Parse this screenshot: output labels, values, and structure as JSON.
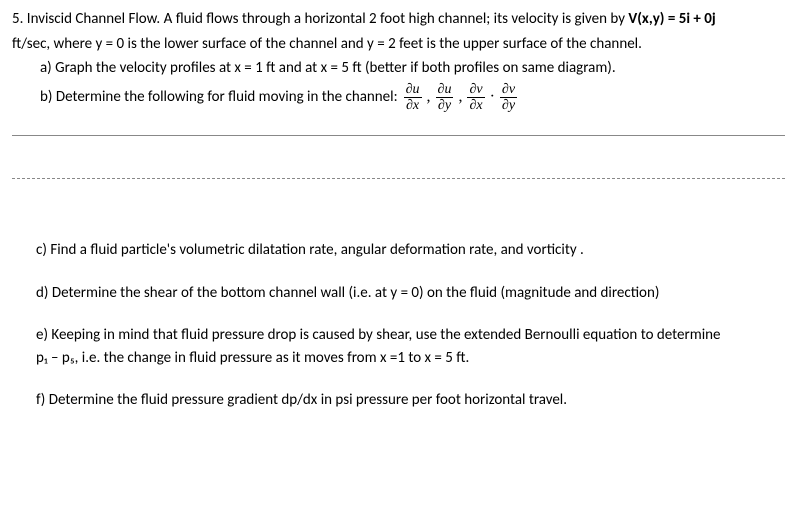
{
  "problem": {
    "number": "5.",
    "title": "Inviscid Channel Flow.",
    "description_line1": "A fluid flows through a horizontal 2 foot high channel; its velocity is given by ",
    "velocity_eq": "V(x,y) = 5i + 0j",
    "description_line2": "ft/sec, where y = 0 is the lower surface of the channel and y = 2 feet is the upper surface of the channel."
  },
  "parts": {
    "a": {
      "label": "a)",
      "text": "Graph the velocity profiles at x = 1 ft and at x = 5 ft (better if both profiles on same diagram)."
    },
    "b": {
      "label": "b)",
      "text": "Determine the following for fluid moving in the channel: ",
      "d1_num": "∂u",
      "d1_den": "∂x",
      "d2_num": "∂u",
      "d2_den": "∂y",
      "d3_num": "∂v",
      "d3_den": "∂x",
      "d4_num": "∂v",
      "d4_den": "∂y"
    },
    "c": {
      "label": "c)",
      "text": "Find a fluid particle's volumetric dilatation rate, angular deformation rate, and vorticity ."
    },
    "d": {
      "label": "d)",
      "text": "Determine the shear of the bottom channel wall (i.e. at y = 0) on the fluid (magnitude and direction)"
    },
    "e": {
      "label": "e)",
      "text_line1": "Keeping in mind that fluid pressure drop is caused by shear, use the extended Bernoulli equation to determine",
      "text_line2": "p₁ – p₅, i.e. the change in fluid pressure as it moves from x =1 to x = 5 ft."
    },
    "f": {
      "label": "f)",
      "text": "Determine the fluid pressure gradient dp/dx in psi pressure per foot horizontal travel."
    }
  }
}
